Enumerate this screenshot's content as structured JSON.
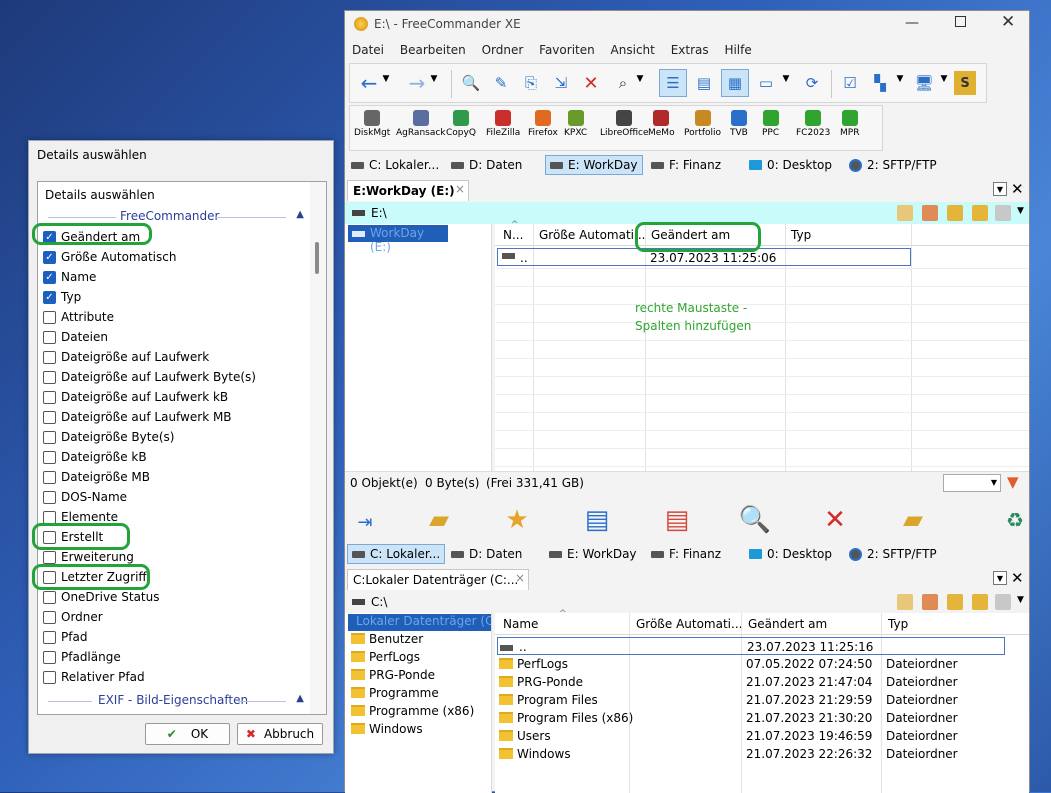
{
  "dialog": {
    "title": "Details auswählen",
    "list_header": "Details auswählen",
    "groups": {
      "freecommander": "FreeCommander",
      "exif": "EXIF - Bild-Eigenschaften"
    },
    "items": [
      {
        "label": "Geändert am",
        "checked": true
      },
      {
        "label": "Größe Automatisch",
        "checked": true
      },
      {
        "label": "Name",
        "checked": true
      },
      {
        "label": "Typ",
        "checked": true
      },
      {
        "label": "Attribute",
        "checked": false
      },
      {
        "label": "Dateien",
        "checked": false
      },
      {
        "label": "Dateigröße auf Laufwerk",
        "checked": false
      },
      {
        "label": "Dateigröße auf Laufwerk Byte(s)",
        "checked": false
      },
      {
        "label": "Dateigröße auf Laufwerk kB",
        "checked": false
      },
      {
        "label": "Dateigröße auf Laufwerk MB",
        "checked": false
      },
      {
        "label": "Dateigröße Byte(s)",
        "checked": false
      },
      {
        "label": "Dateigröße kB",
        "checked": false
      },
      {
        "label": "Dateigröße MB",
        "checked": false
      },
      {
        "label": "DOS-Name",
        "checked": false
      },
      {
        "label": "Elemente",
        "checked": false
      },
      {
        "label": "Erstellt",
        "checked": false
      },
      {
        "label": "Erweiterung",
        "checked": false
      },
      {
        "label": "Letzter Zugriff",
        "checked": false
      },
      {
        "label": "OneDrive Status",
        "checked": false
      },
      {
        "label": "Ordner",
        "checked": false
      },
      {
        "label": "Pfad",
        "checked": false
      },
      {
        "label": "Pfadlänge",
        "checked": false
      },
      {
        "label": "Relativer Pfad",
        "checked": false
      }
    ],
    "ok": "OK",
    "cancel": "Abbruch",
    "checkmark": "✓"
  },
  "window": {
    "title": "E:\\ - FreeCommander XE",
    "menu": [
      "Datei",
      "Bearbeiten",
      "Ordner",
      "Favoriten",
      "Ansicht",
      "Extras",
      "Hilfe"
    ],
    "tools": [
      "DiskMgt",
      "AgRansack",
      "CopyQ",
      "FileZilla",
      "Firefox",
      "KPXC",
      "LibreOffice",
      "MeMo",
      "Portfolio",
      "TVB",
      "PPC",
      "FC2023",
      "MPR"
    ],
    "drives": [
      "C: Lokaler...",
      "D: Daten",
      "E: WorkDay",
      "F: Finanz",
      "0: Desktop",
      "2: SFTP/FTP"
    ],
    "top": {
      "tab": "E:WorkDay (E:)",
      "path": "E:\\",
      "tree_item": "WorkDay (E:)",
      "columns": [
        "N...",
        "Größe Automati...",
        "Geändert am",
        "Typ"
      ],
      "row": {
        "name": "..",
        "date": "23.07.2023 11:25:06"
      },
      "annotation": [
        "rechte Maustaste -",
        "Spalten hinzufügen"
      ],
      "status": [
        "0 Objekt(e)",
        "0 Byte(s)",
        "(Frei 331,41 GB)"
      ]
    },
    "bottom": {
      "tab": "C:Lokaler Datenträger (C:...",
      "path": "C:\\",
      "tree": [
        "Lokaler Datenträger (C:)",
        "Benutzer",
        "PerfLogs",
        "PRG-Ponde",
        "Programme",
        "Programme (x86)",
        "Windows"
      ],
      "columns": [
        "Name",
        "Größe Automati...",
        "Geändert am",
        "Typ"
      ],
      "rows": [
        {
          "name": "..",
          "date": "23.07.2023 11:25:16",
          "type": ""
        },
        {
          "name": "PerfLogs",
          "date": "07.05.2022 07:24:50",
          "type": "Dateiordner"
        },
        {
          "name": "PRG-Ponde",
          "date": "21.07.2023 21:47:04",
          "type": "Dateiordner"
        },
        {
          "name": "Program Files",
          "date": "21.07.2023 21:29:59",
          "type": "Dateiordner"
        },
        {
          "name": "Program Files (x86)",
          "date": "21.07.2023 21:30:20",
          "type": "Dateiordner"
        },
        {
          "name": "Users",
          "date": "21.07.2023 19:46:59",
          "type": "Dateiordner"
        },
        {
          "name": "Windows",
          "date": "21.07.2023 22:26:32",
          "type": "Dateiordner"
        }
      ]
    }
  }
}
